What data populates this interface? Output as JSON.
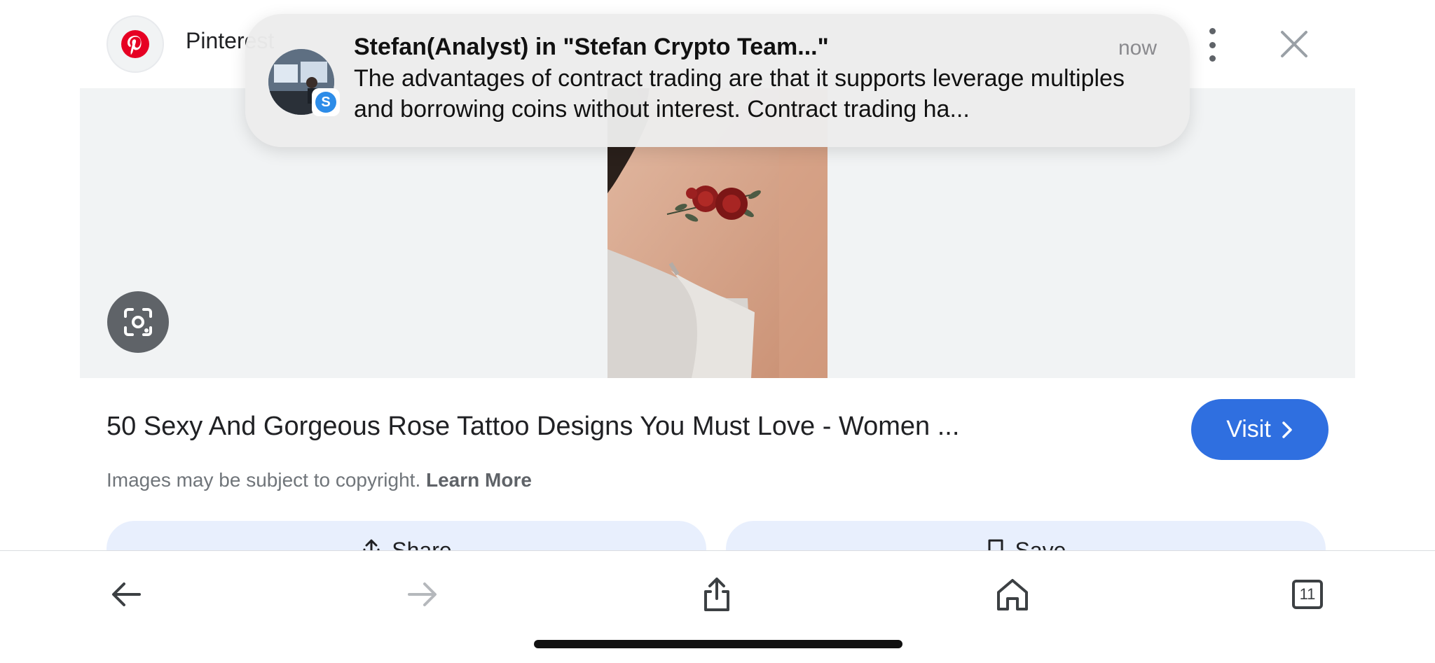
{
  "header": {
    "site_name": "Pinterest",
    "logo_icon": "pinterest-logo",
    "brand_color": "#e60023"
  },
  "notification": {
    "title": "Stefan(Analyst) in \"Stefan Crypto Team...\"",
    "time": "now",
    "body": "The advantages of contract trading are that it supports leverage multiples and borrowing coins without interest. Contract trading ha...",
    "app_badge_letter": "S"
  },
  "result": {
    "title": "50 Sexy And Gorgeous Rose Tattoo Designs You Must Love - Women ...",
    "visit_label": "Visit",
    "copyright_text": "Images may be subject to copyright.",
    "learn_more": "Learn More",
    "accent_color": "#2f6fe0"
  },
  "actions": {
    "share_label": "Share",
    "save_label": "Save"
  },
  "toolbar": {
    "tabs_count": "11"
  }
}
